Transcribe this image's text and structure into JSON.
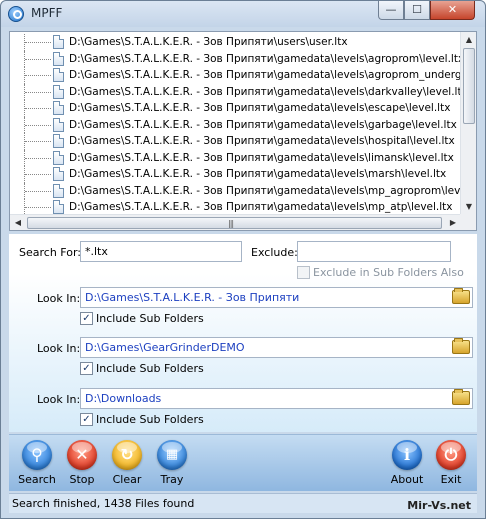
{
  "window": {
    "title": "MPFF"
  },
  "title_buttons": {
    "minimize": "—",
    "maximize": "☐",
    "close": "✕"
  },
  "tree": {
    "items": [
      "D:\\Games\\S.T.A.L.K.E.R. - Зов Припяти\\users\\user.ltx",
      "D:\\Games\\S.T.A.L.K.E.R. - Зов Припяти\\gamedata\\levels\\agroprom\\level.ltx",
      "D:\\Games\\S.T.A.L.K.E.R. - Зов Припяти\\gamedata\\levels\\agroprom_underground",
      "D:\\Games\\S.T.A.L.K.E.R. - Зов Припяти\\gamedata\\levels\\darkvalley\\level.ltx",
      "D:\\Games\\S.T.A.L.K.E.R. - Зов Припяти\\gamedata\\levels\\escape\\level.ltx",
      "D:\\Games\\S.T.A.L.K.E.R. - Зов Припяти\\gamedata\\levels\\garbage\\level.ltx",
      "D:\\Games\\S.T.A.L.K.E.R. - Зов Припяти\\gamedata\\levels\\hospital\\level.ltx",
      "D:\\Games\\S.T.A.L.K.E.R. - Зов Припяти\\gamedata\\levels\\limansk\\level.ltx",
      "D:\\Games\\S.T.A.L.K.E.R. - Зов Припяти\\gamedata\\levels\\marsh\\level.ltx",
      "D:\\Games\\S.T.A.L.K.E.R. - Зов Припяти\\gamedata\\levels\\mp_agroprom\\level.ltx",
      "D:\\Games\\S.T.A.L.K.E.R. - Зов Припяти\\gamedata\\levels\\mp_atp\\level.ltx"
    ]
  },
  "search": {
    "search_for_label": "Search For:",
    "search_for_value": "*.ltx",
    "exclude_label": "Exclude:",
    "exclude_value": "",
    "exclude_sub_label": "Exclude in Sub Folders Also",
    "exclude_sub_checked": false
  },
  "locations": [
    {
      "label": "Look In:",
      "path": "D:\\Games\\S.T.A.L.K.E.R. - Зов Припяти",
      "include_label": "Include Sub Folders",
      "include_checked": true
    },
    {
      "label": "Look In:",
      "path": "D:\\Games\\GearGrinderDEMO",
      "include_label": "Include Sub Folders",
      "include_checked": true
    },
    {
      "label": "Look In:",
      "path": "D:\\Downloads",
      "include_label": "Include Sub Folders",
      "include_checked": true
    }
  ],
  "toolbar": {
    "search": "Search",
    "stop": "Stop",
    "clear": "Clear",
    "tray": "Tray",
    "about": "About",
    "exit": "Exit"
  },
  "icons": {
    "search": "magnifier-icon",
    "stop": "x-icon",
    "clear": "swirl-icon",
    "tray": "windows-flag-icon",
    "about": "info-icon",
    "exit": "power-icon"
  },
  "colors": {
    "search_orb": "#2d7fd8",
    "stop_orb": "#e03a24",
    "clear_orb": "#f3b51f",
    "tray_orb": "#2d7fd8",
    "about_orb": "#1f6fd0",
    "exit_orb": "#e03a24"
  },
  "status": {
    "text": "Search finished, 1438 Files found",
    "watermark": "Mir-Vs.net"
  }
}
